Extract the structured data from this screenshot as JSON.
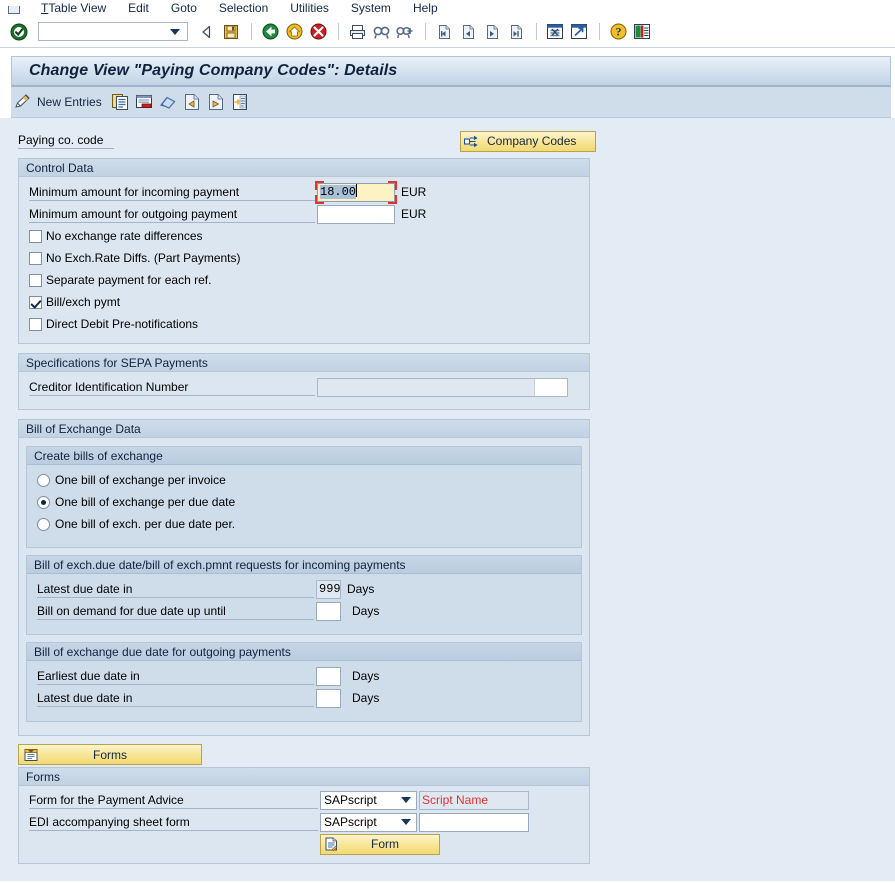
{
  "menu": {
    "items": [
      {
        "label": "Table View",
        "accel": "T"
      },
      {
        "label": "Edit",
        "accel": "E"
      },
      {
        "label": "Goto",
        "accel": "G"
      },
      {
        "label": "Selection",
        "accel": "S"
      },
      {
        "label": "Utilities",
        "accel": "U"
      },
      {
        "label": "System",
        "accel": "y"
      },
      {
        "label": "Help",
        "accel": "H"
      }
    ]
  },
  "toolbar": {
    "command_value": "",
    "command_placeholder": "",
    "icons": [
      "enter-check-icon",
      "command-dropdown-icon",
      "back-arrow-icon",
      "save-icon",
      "back-green-icon",
      "exit-yellow-icon",
      "cancel-red-icon",
      "print-icon",
      "find-icon",
      "find-next-icon",
      "first-page-icon",
      "previous-page-icon",
      "next-page-icon",
      "last-page-icon",
      "create-session-icon",
      "create-shortcut-icon",
      "help-icon",
      "customize-layout-icon"
    ]
  },
  "title": "Change View \"Paying Company Codes\": Details",
  "app_toolbar": {
    "new_entries_label": "New Entries",
    "icons": [
      "display-change-icon",
      "copy-as-icon",
      "delete-icon",
      "undo-icon",
      "previous-entry-icon",
      "next-entry-icon",
      "details-icon"
    ]
  },
  "header": {
    "paying_cocode_label": "Paying co. code",
    "paying_cocode_value": "",
    "company_codes_button": "Company Codes"
  },
  "control_data": {
    "title": "Control Data",
    "min_incoming_label": "Minimum amount for incoming payment",
    "min_incoming_value": "18.00",
    "min_incoming_currency": "EUR",
    "min_outgoing_label": "Minimum amount for outgoing payment",
    "min_outgoing_value": "",
    "min_outgoing_currency": "EUR",
    "checkboxes": [
      {
        "label": "No exchange rate differences",
        "checked": false
      },
      {
        "label": "No Exch.Rate Diffs. (Part Payments)",
        "checked": false
      },
      {
        "label": "Separate payment for each ref.",
        "checked": false
      },
      {
        "label": "Bill/exch pymt",
        "checked": true
      },
      {
        "label": "Direct Debit Pre-notifications",
        "checked": false
      }
    ]
  },
  "sepa": {
    "title": "Specifications for SEPA Payments",
    "creditor_id_label": "Creditor Identification Number",
    "creditor_id_value": ""
  },
  "bill_of_exchange": {
    "title": "Bill of Exchange Data",
    "create_bills": {
      "title": "Create bills of exchange",
      "options": [
        {
          "label": "One bill of exchange per invoice",
          "selected": false
        },
        {
          "label": "One bill of exchange per due date",
          "selected": true
        },
        {
          "label": "One bill of exch. per due date per.",
          "selected": false
        }
      ]
    },
    "incoming": {
      "title": "Bill of exch.due date/bill of exch.pmnt requests for incoming payments",
      "rows": [
        {
          "label": "Latest due date in",
          "value": "999",
          "unit": "Days",
          "readonly": true
        },
        {
          "label": "Bill on demand for due date up until",
          "value": "",
          "unit": "Days",
          "readonly": false
        }
      ]
    },
    "outgoing": {
      "title": "Bill of exchange due date for outgoing payments",
      "rows": [
        {
          "label": "Earliest due date in",
          "value": "",
          "unit": "Days",
          "readonly": false
        },
        {
          "label": "Latest due date in",
          "value": "",
          "unit": "Days",
          "readonly": false
        }
      ]
    }
  },
  "forms": {
    "button_label": "Forms",
    "title": "Forms",
    "payment_advice_label": "Form for the Payment Advice",
    "payment_advice_type": "SAPscript",
    "payment_advice_name": "Script Name",
    "edi_label": "EDI accompanying sheet form",
    "edi_type": "SAPscript",
    "edi_name": "",
    "form_button_label": "Form"
  },
  "colors": {
    "canvas_bg": "#e3ebf4",
    "group_bg": "#dce6f1",
    "subgroup_bg": "#cfdcea",
    "accent_gold": "#f2d972",
    "focus_red": "#e03232",
    "hint_red": "#e03232",
    "focus_field_bg": "#fdf2c4"
  }
}
